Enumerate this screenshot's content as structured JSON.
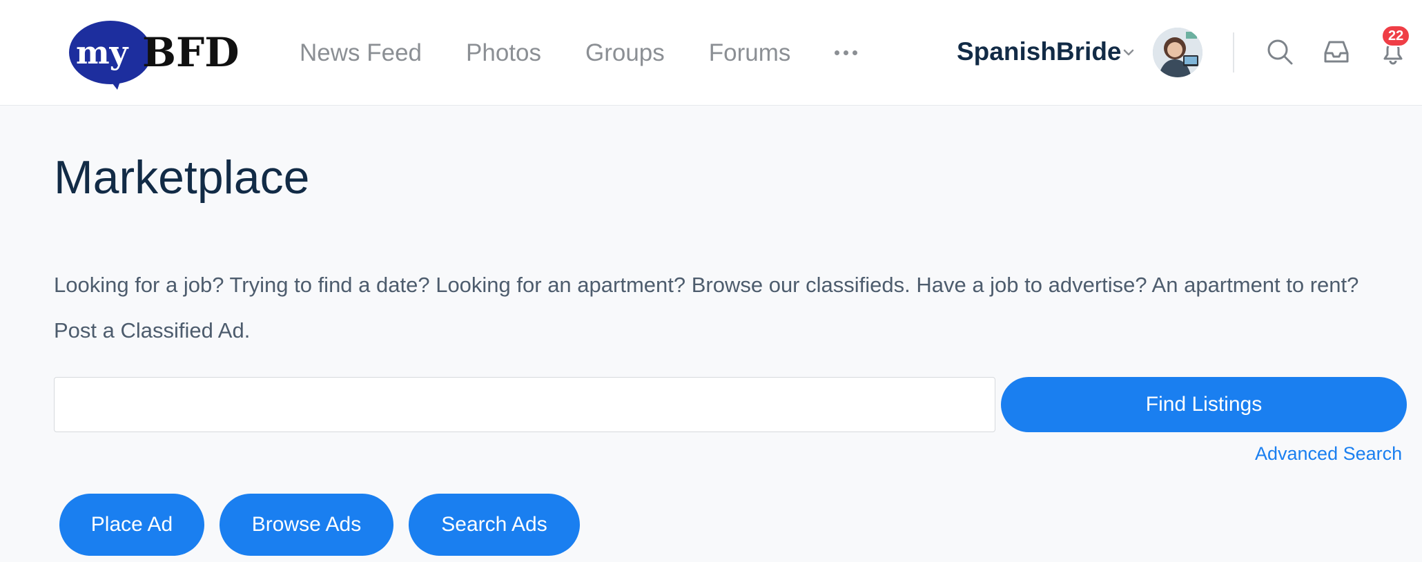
{
  "header": {
    "logo": {
      "text_my": "my",
      "text_bfd": "BFD",
      "icon": "speech-bubble-logo"
    },
    "nav": [
      {
        "label": "News Feed"
      },
      {
        "label": "Photos"
      },
      {
        "label": "Groups"
      },
      {
        "label": "Forums"
      }
    ],
    "more_icon": "ellipsis-icon",
    "user": {
      "name": "SpanishBride",
      "chevron_icon": "chevron-down-icon",
      "avatar_icon": "user-avatar"
    },
    "icons": {
      "search": "search-icon",
      "inbox": "inbox-icon",
      "notifications": "bell-icon"
    },
    "notification_count": "22"
  },
  "main": {
    "title": "Marketplace",
    "intro": "Looking for a job? Trying to find a date? Looking for an apartment? Browse our classifieds. Have a job to advertise? An apartment to rent? Post a Classified Ad.",
    "search": {
      "value": "",
      "placeholder": ""
    },
    "find_button": "Find Listings",
    "advanced_search": "Advanced Search",
    "actions": {
      "place_ad": "Place Ad",
      "browse_ads": "Browse Ads",
      "search_ads": "Search Ads"
    }
  },
  "colors": {
    "accent": "#1a7ff0",
    "title": "#122b46",
    "nav_text": "#8b8f94",
    "badge": "#ef3e46",
    "page_bg": "#f8f9fb",
    "logo_blue": "#1d2e9e"
  }
}
